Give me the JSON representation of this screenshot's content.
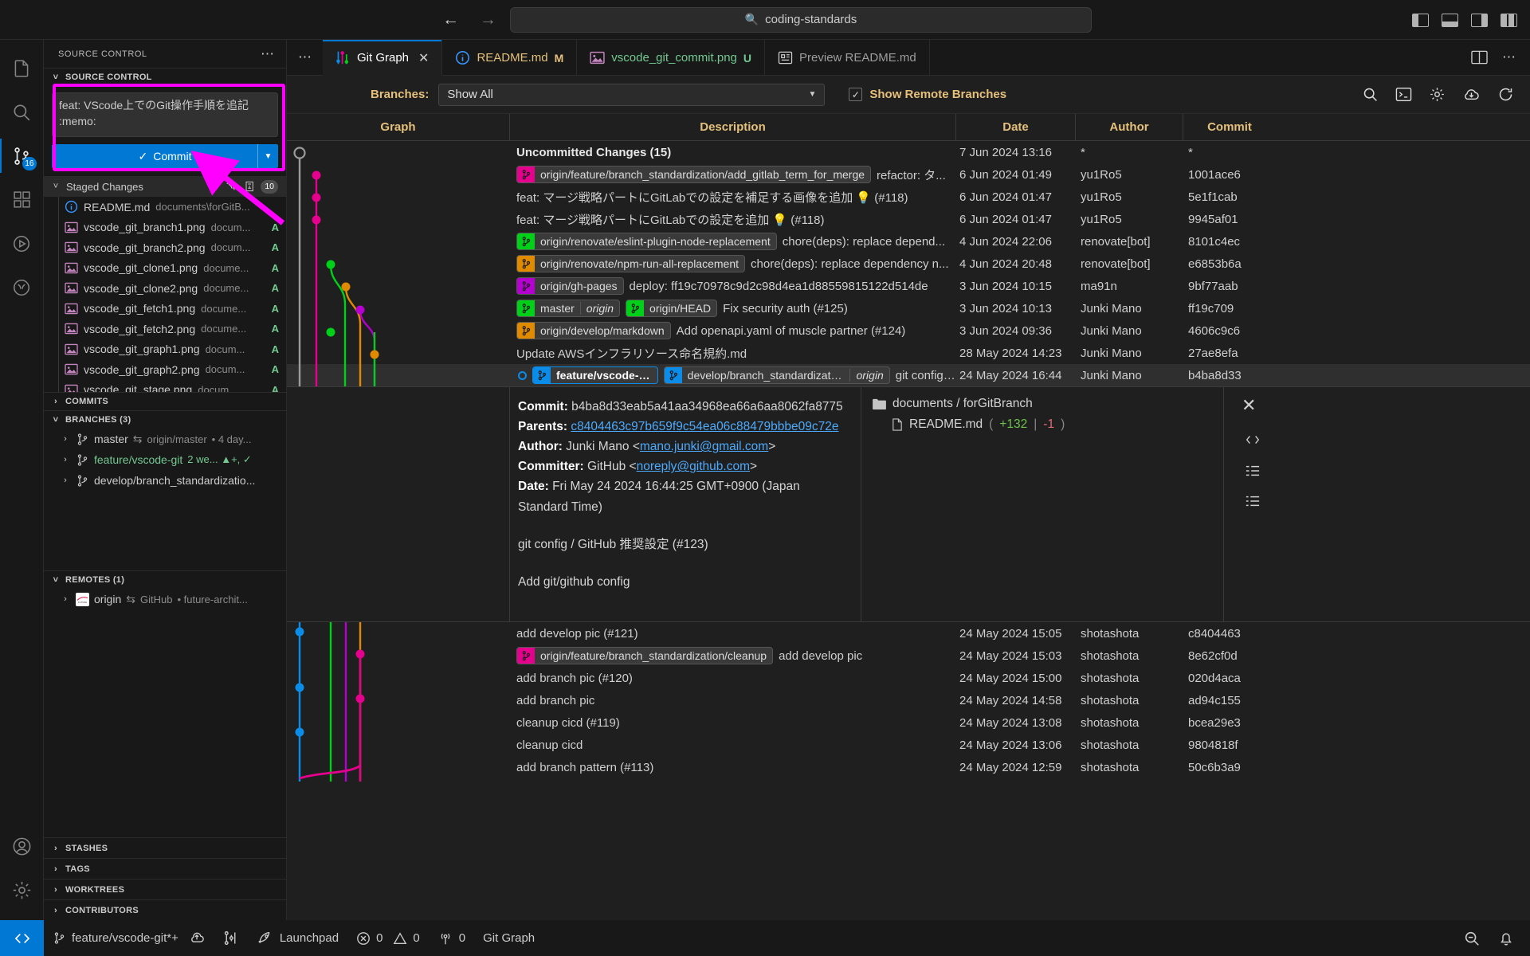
{
  "titlebar": {
    "back_icon": "arrow-left-icon",
    "forward_icon": "arrow-right-icon",
    "search_placeholder": "coding-standards",
    "search_value": "coding-standards",
    "search_icon": "search-icon",
    "layout_icons": [
      "toggle-primary-sidebar-icon",
      "toggle-panel-icon",
      "toggle-secondary-sidebar-icon",
      "customize-layout-icon"
    ]
  },
  "activitybar": {
    "items": [
      {
        "name": "explorer",
        "icon": "files-icon",
        "badge": ""
      },
      {
        "name": "search",
        "icon": "search-icon",
        "badge": ""
      },
      {
        "name": "source-control",
        "icon": "source-control-icon",
        "badge": "16"
      },
      {
        "name": "extensions",
        "icon": "extensions-icon",
        "badge": ""
      },
      {
        "name": "run-and-debug",
        "icon": "run-debug-icon",
        "badge": ""
      },
      {
        "name": "testing",
        "icon": "beaker-icon",
        "badge": ""
      }
    ],
    "bottom": [
      {
        "name": "accounts",
        "icon": "account-icon"
      },
      {
        "name": "settings",
        "icon": "gear-icon"
      }
    ]
  },
  "sidebar": {
    "title": "SOURCE CONTROL",
    "more_icon": "ellipsis-icon",
    "scm_section_label": "SOURCE CONTROL",
    "commit_message": "feat: VScode上でのGit操作手順を追記 :memo:",
    "commit_button_label": "Commit",
    "commit_button_check_icon": "check-icon",
    "commit_dropdown_icon": "chevron-down-icon",
    "staged": {
      "label": "Staged Changes",
      "count": "10",
      "action_icons": [
        "unstage-all-icon",
        "stage-view-icon"
      ],
      "files": [
        {
          "icon": "info-icon",
          "name": "README.md",
          "path": "documents\\forGitB...",
          "status": ""
        },
        {
          "icon": "image-icon",
          "name": "vscode_git_branch1.png",
          "path": "docum...",
          "status": "A"
        },
        {
          "icon": "image-icon",
          "name": "vscode_git_branch2.png",
          "path": "docum...",
          "status": "A"
        },
        {
          "icon": "image-icon",
          "name": "vscode_git_clone1.png",
          "path": "docume...",
          "status": "A"
        },
        {
          "icon": "image-icon",
          "name": "vscode_git_clone2.png",
          "path": "docume...",
          "status": "A"
        },
        {
          "icon": "image-icon",
          "name": "vscode_git_fetch1.png",
          "path": "docume...",
          "status": "A"
        },
        {
          "icon": "image-icon",
          "name": "vscode_git_fetch2.png",
          "path": "docume...",
          "status": "A"
        },
        {
          "icon": "image-icon",
          "name": "vscode_git_graph1.png",
          "path": "docum...",
          "status": "A"
        },
        {
          "icon": "image-icon",
          "name": "vscode_git_graph2.png",
          "path": "docum...",
          "status": "A"
        },
        {
          "icon": "image-icon",
          "name": "vscode_git_stage.png",
          "path": "docum...",
          "status": "A"
        }
      ]
    },
    "commits_label": "COMMITS",
    "branches_label": "BRANCHES (3)",
    "branches": [
      {
        "name": "master",
        "sync_icon": "sync-arrows-icon",
        "upstream": "origin/master",
        "meta": "• 4 day...",
        "current": false
      },
      {
        "name": "feature/vscode-git",
        "sync_icon": "",
        "upstream": "",
        "meta": "2 we... ▲+, ✓",
        "current": true
      },
      {
        "name": "develop/branch_standardizatio...",
        "sync_icon": "",
        "upstream": "",
        "meta": "",
        "current": false
      }
    ],
    "remotes_label": "REMOTES (1)",
    "remotes": [
      {
        "name": "origin",
        "sync_icon": "sync-arrows-icon",
        "provider": "GitHub",
        "meta": "• future-archit..."
      }
    ],
    "bottom_sections": [
      "STASHES",
      "TAGS",
      "WORKTREES",
      "CONTRIBUTORS"
    ]
  },
  "editor": {
    "tabs": [
      {
        "label": "Git Graph",
        "icon": "git-graph-icon",
        "badge": "",
        "active": true,
        "closable": true
      },
      {
        "label": "README.md",
        "icon": "info-icon",
        "badge": "M",
        "active": false,
        "closable": false
      },
      {
        "label": "vscode_git_commit.png",
        "icon": "image-icon",
        "badge": "U",
        "active": false,
        "closable": false
      },
      {
        "label": "Preview README.md",
        "icon": "preview-icon",
        "badge": "",
        "active": false,
        "closable": false
      }
    ],
    "tabbar_actions": [
      "split-editor-icon",
      "more-actions-icon"
    ],
    "overflow_icon": "ellipsis-icon"
  },
  "gitgraph": {
    "branches_label": "Branches:",
    "branches_value": "Show All",
    "dropdown_icon": "chevron-down-icon",
    "show_remote_label": "Show Remote Branches",
    "show_remote_checked": true,
    "tools": [
      "search-icon",
      "terminal-icon",
      "gear-icon",
      "cloud-fetch-icon",
      "refresh-icon"
    ],
    "columns": [
      "Graph",
      "Description",
      "Date",
      "Author",
      "Commit"
    ],
    "rows": [
      {
        "refs": [],
        "message": "Uncommitted Changes (15)",
        "bold": true,
        "date": "7 Jun 2024 13:16",
        "author": "*",
        "commit": "*",
        "selected": false,
        "head": false
      },
      {
        "refs": [
          {
            "name": "origin/feature/branch_standardization/add_gitlab_term_for_merge",
            "color": "#e6008e",
            "sub": ""
          }
        ],
        "message": "refactor: タ...",
        "bold": false,
        "date": "6 Jun 2024 01:49",
        "author": "yu1Ro5",
        "commit": "1001ace6",
        "selected": false,
        "head": false
      },
      {
        "refs": [],
        "message": "feat: マージ戦略パートにGitLabでの設定を補足する画像を追加 💡 (#118)",
        "bold": false,
        "date": "6 Jun 2024 01:47",
        "author": "yu1Ro5",
        "commit": "5e1f1cab",
        "selected": false,
        "head": false
      },
      {
        "refs": [],
        "message": "feat: マージ戦略パートにGitLabでの設定を追加 💡 (#118)",
        "bold": false,
        "date": "6 Jun 2024 01:47",
        "author": "yu1Ro5",
        "commit": "9945af01",
        "selected": false,
        "head": false
      },
      {
        "refs": [
          {
            "name": "origin/renovate/eslint-plugin-node-replacement",
            "color": "#00d118",
            "sub": ""
          }
        ],
        "message": "chore(deps): replace depend...",
        "bold": false,
        "date": "4 Jun 2024 22:06",
        "author": "renovate[bot]",
        "commit": "8101c4ec",
        "selected": false,
        "head": false
      },
      {
        "refs": [
          {
            "name": "origin/renovate/npm-run-all-replacement",
            "color": "#e08a00",
            "sub": ""
          }
        ],
        "message": "chore(deps): replace dependency n...",
        "bold": false,
        "date": "4 Jun 2024 20:48",
        "author": "renovate[bot]",
        "commit": "e6853b6a",
        "selected": false,
        "head": false
      },
      {
        "refs": [
          {
            "name": "origin/gh-pages",
            "color": "#b500d1",
            "sub": ""
          }
        ],
        "message": "deploy: ff19c70978c9d2c98d4ea1d88559815122d514de",
        "bold": false,
        "date": "3 Jun 2024 10:15",
        "author": "ma91n",
        "commit": "9bf77aab",
        "selected": false,
        "head": false
      },
      {
        "refs": [
          {
            "name": "master",
            "color": "#00d118",
            "sub": "origin"
          },
          {
            "name": "origin/HEAD",
            "color": "#00d118",
            "sub": ""
          }
        ],
        "message": "Fix security auth (#125)",
        "bold": false,
        "date": "3 Jun 2024 10:13",
        "author": "Junki Mano",
        "commit": "ff19c709",
        "selected": false,
        "head": false
      },
      {
        "refs": [
          {
            "name": "origin/develop/markdown",
            "color": "#e08a00",
            "sub": ""
          }
        ],
        "message": "Add openapi.yaml of muscle partner (#124)",
        "bold": false,
        "date": "3 Jun 2024 09:36",
        "author": "Junki Mano",
        "commit": "4606c9c6",
        "selected": false,
        "head": false
      },
      {
        "refs": [],
        "message": "Update AWSインフラリソース命名規約.md",
        "bold": false,
        "date": "28 May 2024 14:23",
        "author": "Junki Mano",
        "commit": "27ae8efa",
        "selected": false,
        "head": false
      },
      {
        "refs": [
          {
            "name": "feature/vscode-git",
            "color": "#0b8ce9",
            "sub": "",
            "is_head": true
          },
          {
            "name": "develop/branch_standardization",
            "color": "#0b8ce9",
            "sub": "origin"
          }
        ],
        "message": "git config ...",
        "bold": false,
        "date": "24 May 2024 16:44",
        "author": "Junki Mano",
        "commit": "b4ba8d33",
        "selected": true,
        "head": true
      }
    ],
    "rows_below": [
      {
        "refs": [],
        "message": "add develop pic (#121)",
        "date": "24 May 2024 15:05",
        "author": "shotashota",
        "commit": "c8404463"
      },
      {
        "refs": [
          {
            "name": "origin/feature/branch_standardization/cleanup",
            "color": "#e6008e",
            "sub": ""
          }
        ],
        "message": "add develop pic",
        "date": "24 May 2024 15:03",
        "author": "shotashota",
        "commit": "8e62cf0d"
      },
      {
        "refs": [],
        "message": "add branch pic (#120)",
        "date": "24 May 2024 15:00",
        "author": "shotashota",
        "commit": "020d4aca"
      },
      {
        "refs": [],
        "message": "add branch pic",
        "date": "24 May 2024 14:58",
        "author": "shotashota",
        "commit": "ad94c155"
      },
      {
        "refs": [],
        "message": "cleanup cicd (#119)",
        "date": "24 May 2024 13:08",
        "author": "shotashota",
        "commit": "bcea29e3"
      },
      {
        "refs": [],
        "message": "cleanup cicd",
        "date": "24 May 2024 13:06",
        "author": "shotashota",
        "commit": "9804818f"
      },
      {
        "refs": [],
        "message": "add branch pattern (#113)",
        "date": "24 May 2024 12:59",
        "author": "shotashota",
        "commit": "50c6b3a9"
      }
    ]
  },
  "commit_detail": {
    "commit_label": "Commit:",
    "commit_hash": "b4ba8d33eab5a41aa34968ea66a6aa8062fa8775",
    "parents_label": "Parents:",
    "parents_hash": "c8404463c97b659f9c54ea06c88479bbbe09c72e",
    "author_label": "Author:",
    "author_name": "Junki Mano",
    "author_email": "mano.junki@gmail.com",
    "committer_label": "Committer:",
    "committer_name": "GitHub",
    "committer_email": "noreply@github.com",
    "date_label": "Date:",
    "date_value": "Fri May 24 2024 16:44:25 GMT+0900 (Japan Standard Time)",
    "body_line1": "git config / GitHub 推奨設定 (#123)",
    "body_line2": "Add git/github config",
    "files": {
      "folder_icon": "folder-icon",
      "folder": "documents / forGitBranch",
      "file_icon": "file-icon",
      "file": "README.md",
      "additions": "+132",
      "deletions": "-1"
    },
    "close_icon": "close-icon",
    "rail_icons": [
      "code-review-icon",
      "file-tree-icon",
      "file-list-icon"
    ]
  },
  "statusbar": {
    "remote_icon": "remote-window-icon",
    "branch_icon": "git-branch-icon",
    "branch": "feature/vscode-git*+",
    "sync_icon": "cloud-sync-icon",
    "graph_icon": "git-graph-icon",
    "launchpad_icon": "rocket-icon",
    "launchpad_label": "Launchpad",
    "errors_icon": "error-icon",
    "errors": "0",
    "warnings_icon": "warning-icon",
    "warnings": "0",
    "ports_icon": "radio-tower-icon",
    "ports": "0",
    "gitgraph_label": "Git Graph",
    "right_icons": [
      "zoom-out-icon",
      "bell-icon"
    ]
  },
  "colors": {
    "accent": "#0078d4",
    "highlight": "#ff00ff",
    "added": "#73c991",
    "branch_magenta": "#e6008e",
    "branch_green": "#00d118",
    "branch_orange": "#e08a00",
    "branch_purple": "#b500d1",
    "branch_blue": "#0b8ce9"
  }
}
